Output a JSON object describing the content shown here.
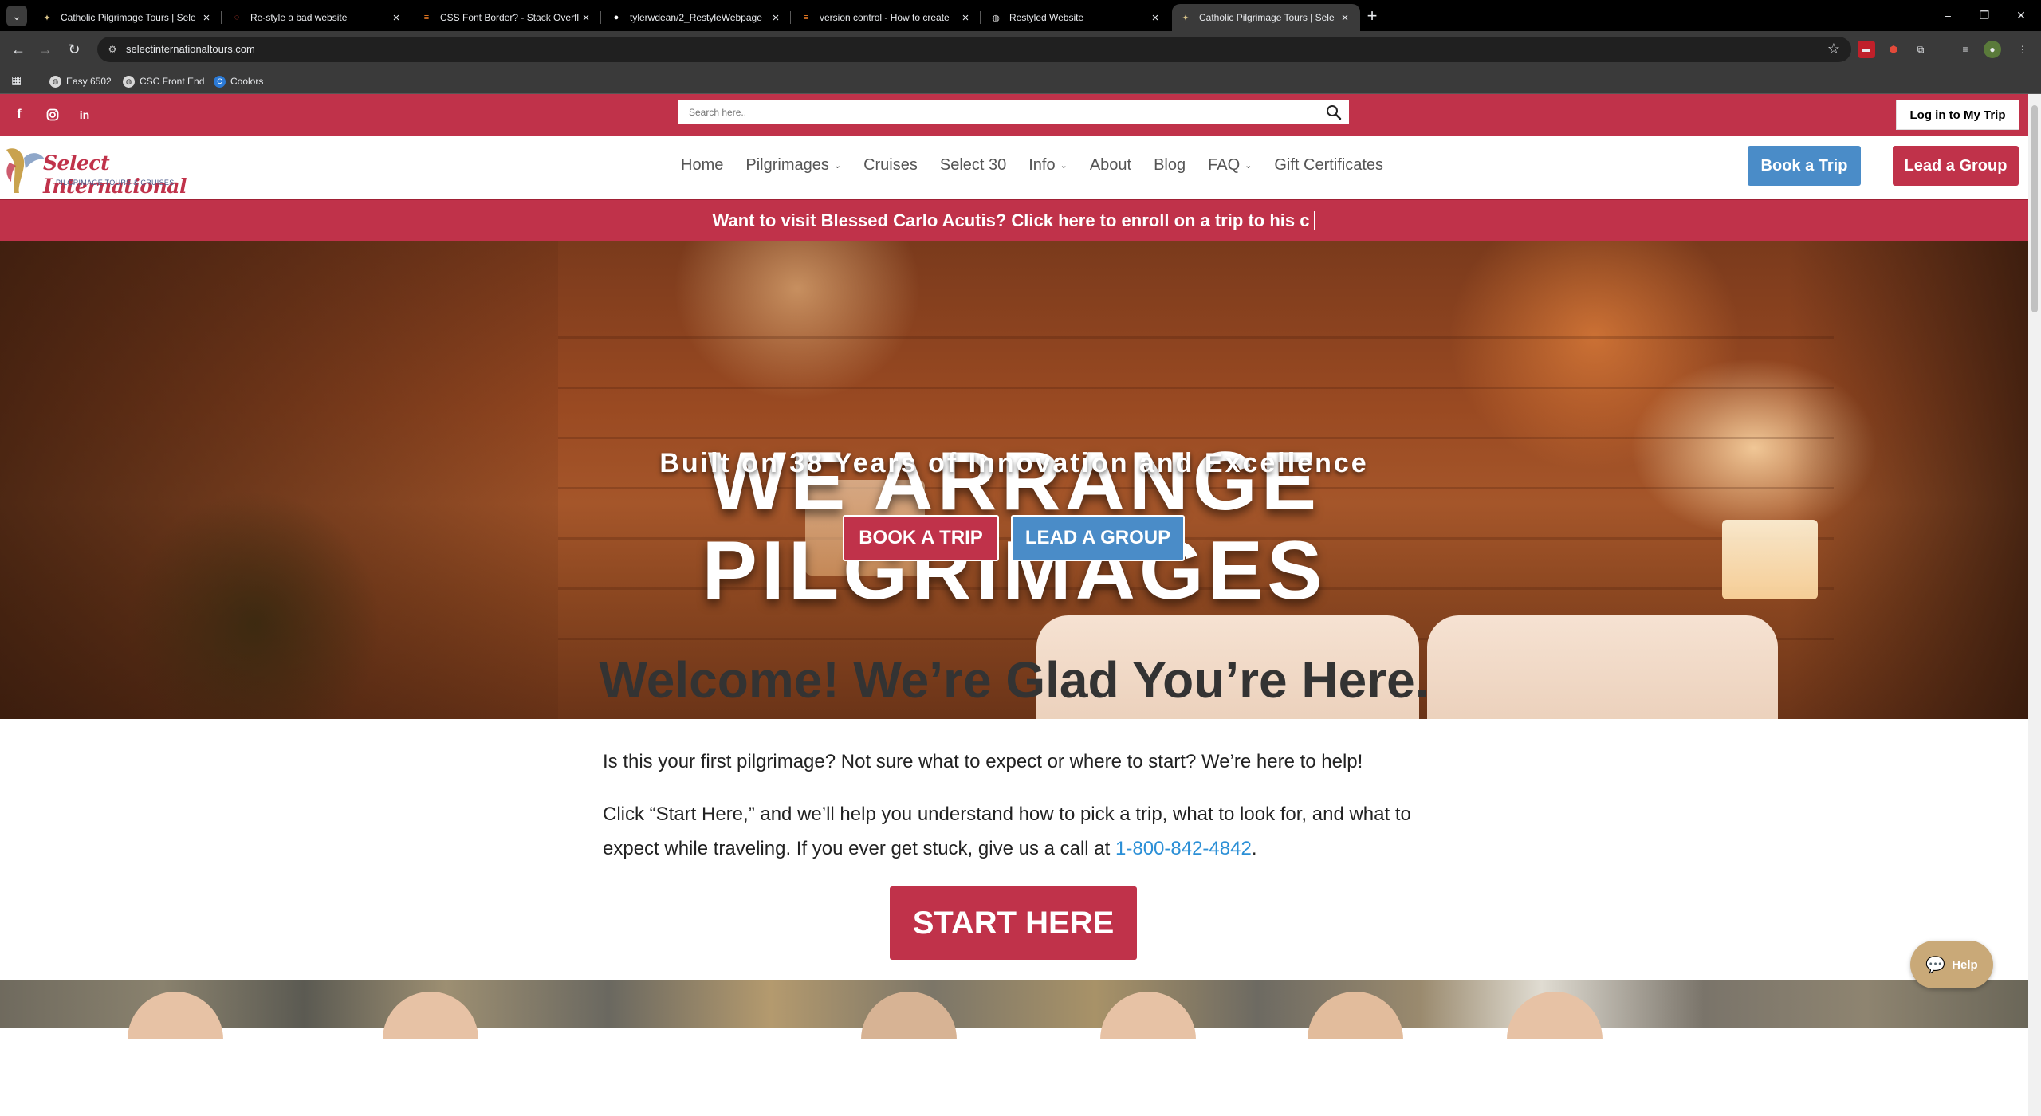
{
  "browser": {
    "tabs": [
      {
        "title": "Catholic Pilgrimage Tours | Sele",
        "favicon": "dove-icon",
        "active": false
      },
      {
        "title": "Re-style a bad website",
        "favicon": "spinner-icon",
        "active": false
      },
      {
        "title": "CSS Font Border? - Stack Overfl",
        "favicon": "stackoverflow-icon",
        "active": false
      },
      {
        "title": "tylerwdean/2_RestyleWebpage",
        "favicon": "github-icon",
        "active": false
      },
      {
        "title": "version control - How to create",
        "favicon": "stackoverflow-icon",
        "active": false
      },
      {
        "title": "Restyled Website",
        "favicon": "globe-icon",
        "active": false
      },
      {
        "title": "Catholic Pilgrimage Tours | Sele",
        "favicon": "dove-icon",
        "active": true
      }
    ],
    "url": "selectinternationaltours.com",
    "bookmarks": [
      {
        "label": "Easy 6502"
      },
      {
        "label": "CSC Front End"
      },
      {
        "label": "Coolors"
      }
    ]
  },
  "site": {
    "topbar": {
      "search_placeholder": "Search here..",
      "login_label": "Log in to My Trip"
    },
    "logo": {
      "script": "Select International",
      "subtitle": "PILGRIMAGE TOURS & CRUISES"
    },
    "menu": [
      {
        "label": "Home",
        "dropdown": false
      },
      {
        "label": "Pilgrimages",
        "dropdown": true
      },
      {
        "label": "Cruises",
        "dropdown": false
      },
      {
        "label": "Select 30",
        "dropdown": false
      },
      {
        "label": "Info",
        "dropdown": true
      },
      {
        "label": "About",
        "dropdown": false
      },
      {
        "label": "Blog",
        "dropdown": false
      },
      {
        "label": "FAQ",
        "dropdown": true
      },
      {
        "label": "Gift Certificates",
        "dropdown": false
      }
    ],
    "header_buttons": {
      "book": "Book a Trip",
      "lead": "Lead a Group"
    },
    "announcement": "Want to visit Blessed Carlo Acutis? Click here to enroll on a trip to his c",
    "hero": {
      "title_line1": "WE ARRANGE",
      "title_line2": "PILGRIMAGES",
      "subtitle": "Built on 38 Years of Innovation and Excellence",
      "book_label": "BOOK A TRIP",
      "lead_label": "LEAD A GROUP"
    },
    "welcome": {
      "title": "Welcome! We’re Glad You’re Here.",
      "para1": "Is this your first pilgrimage? Not sure what to expect or where to start? We’re here to help!",
      "para2_before": "Click “Start Here,” and we’ll help you understand how to pick a trip, what to look for, and what to expect while traveling. If you ever get stuck, give us a call at",
      "phone": "1-800-842-4842",
      "para2_after": ".",
      "start_label": "START HERE"
    },
    "help_label": "Help"
  },
  "colors": {
    "brand_red": "#c0324a",
    "brand_blue": "#4a8cc8",
    "link_blue": "#2b8fd6",
    "help_tan": "#c9a978"
  }
}
